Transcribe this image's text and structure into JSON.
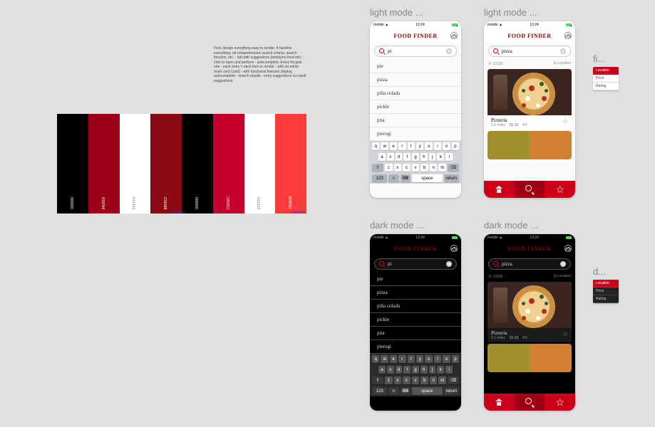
{
  "notes": "First, design everything easy to render. It handles everything: all comprehensive search criteria, search function, etc.\n\n- tab with suggestions (empty/no food etc)\n- click to open and perform\n- autocomplete. Every hit gets one\n- each entry = each item to render\n- with an entire route card (card)\n- with functional features display, autocomplete\n- search results\n- entry suggestions so result suggestions",
  "palette": {
    "swatches": [
      {
        "color": "#000000",
        "textColor": "#fff",
        "code": "000000"
      },
      {
        "color": "#9A0018",
        "textColor": "#fff",
        "code": "9A0018"
      },
      {
        "color": "#FFFFFF",
        "textColor": "#888",
        "code": "FFFFFF"
      },
      {
        "color": "#8B0912",
        "textColor": "#fff",
        "code": "8B0912"
      },
      {
        "color": "#000000",
        "textColor": "#fff",
        "code": "000000"
      },
      {
        "color": "#C5002C",
        "textColor": "#fff",
        "code": "C5002C"
      },
      {
        "color": "#FFFFFF",
        "textColor": "#888",
        "code": "FFFFFF"
      },
      {
        "color": "#FB3B3A",
        "textColor": "#fff",
        "code": "FB3B3A"
      }
    ],
    "footer": "coolors"
  },
  "frames": {
    "light_search": "light mode ...",
    "light_results": "light mode ...",
    "light_filter": "fi...",
    "dark_search": "dark mode ...",
    "dark_results": "dark mode ...",
    "dark_filter": "d..."
  },
  "status": {
    "carrier": "mobile",
    "time": "13:24"
  },
  "app": {
    "title": "FOOD FINDER"
  },
  "search": {
    "query_typing": "pi",
    "query_full": "pizza"
  },
  "suggestions": [
    "pie",
    "pizza",
    "piña colada",
    "pickle",
    "pita",
    "pierogi"
  ],
  "keyboard": {
    "row1": [
      "q",
      "w",
      "e",
      "r",
      "t",
      "y",
      "u",
      "i",
      "o",
      "p"
    ],
    "row2": [
      "a",
      "s",
      "d",
      "f",
      "g",
      "h",
      "j",
      "k",
      "l"
    ],
    "row3": [
      "⇧",
      "z",
      "x",
      "c",
      "v",
      "b",
      "n",
      "m",
      "⌫"
    ],
    "row4": [
      "123",
      "☺",
      "⌨",
      "space",
      "return"
    ]
  },
  "sort": {
    "left": "13126",
    "right": "Location"
  },
  "result1": {
    "name": "Pizzeria",
    "distance": "0.1 miles",
    "price": "$$-$$",
    "rating": "4/5"
  },
  "filter": {
    "items": [
      "Location",
      "Price",
      "Rating"
    ],
    "active": 0
  }
}
